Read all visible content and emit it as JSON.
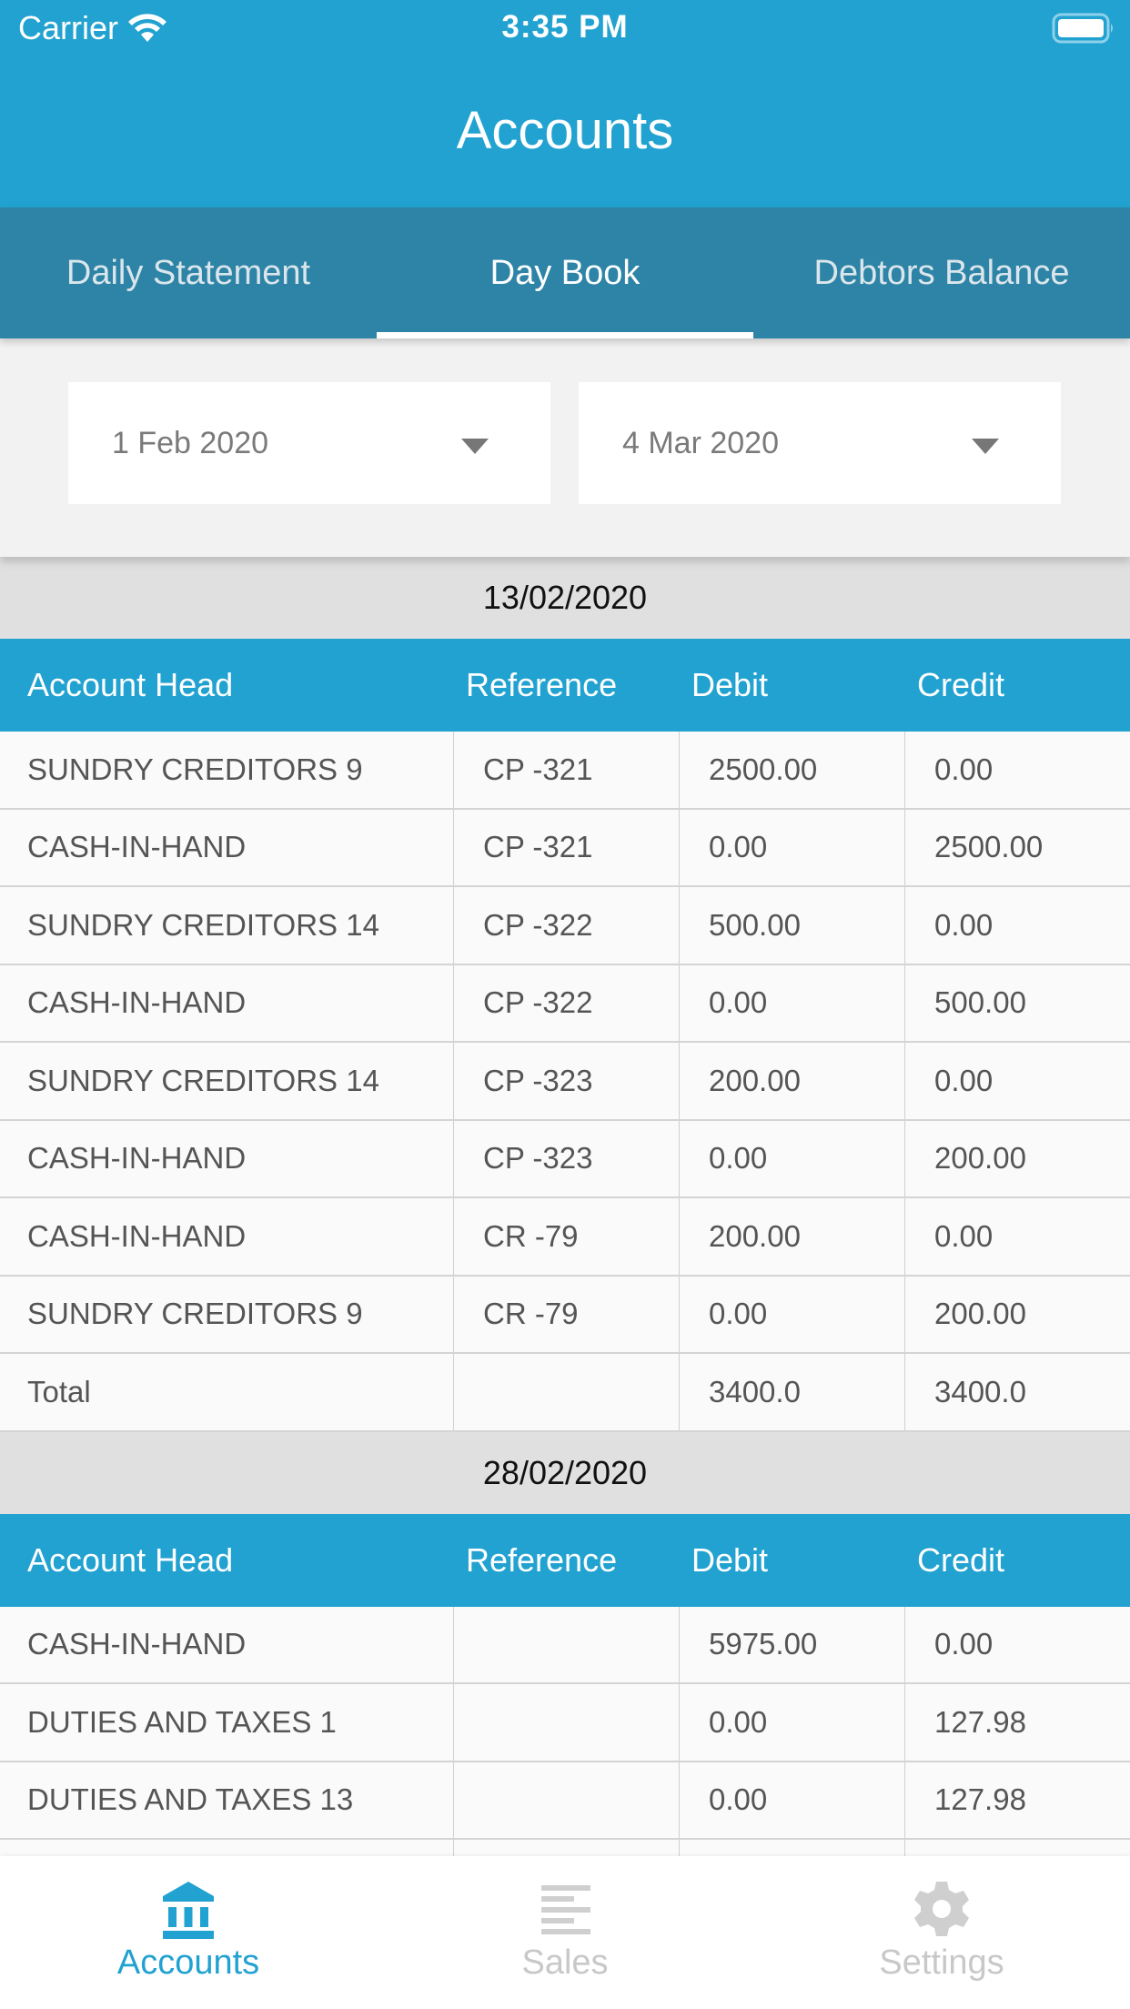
{
  "status_bar": {
    "carrier": "Carrier",
    "time": "3:35 PM",
    "wifi_icon": "wifi-icon",
    "battery_icon": "battery-full-icon"
  },
  "header": {
    "title": "Accounts"
  },
  "tabs": [
    {
      "label": "Daily Statement",
      "active": false
    },
    {
      "label": "Day Book",
      "active": true
    },
    {
      "label": "Debtors Balance",
      "active": false
    }
  ],
  "filters": {
    "from_date": "1 Feb 2020",
    "to_date": "4 Mar 2020",
    "caret_icon": "caret-down-icon"
  },
  "columns": [
    "Account Head",
    "Reference",
    "Debit",
    "Credit"
  ],
  "sections": [
    {
      "date": "13/02/2020",
      "rows": [
        {
          "account": "SUNDRY CREDITORS 9",
          "reference": "CP  -321",
          "debit": "2500.00",
          "credit": "0.00"
        },
        {
          "account": "CASH-IN-HAND",
          "reference": "CP  -321",
          "debit": "0.00",
          "credit": "2500.00"
        },
        {
          "account": "SUNDRY CREDITORS 14",
          "reference": "CP  -322",
          "debit": "500.00",
          "credit": "0.00"
        },
        {
          "account": "CASH-IN-HAND",
          "reference": "CP  -322",
          "debit": "0.00",
          "credit": "500.00"
        },
        {
          "account": "SUNDRY CREDITORS 14",
          "reference": "CP  -323",
          "debit": "200.00",
          "credit": "0.00"
        },
        {
          "account": "CASH-IN-HAND",
          "reference": "CP  -323",
          "debit": "0.00",
          "credit": "200.00"
        },
        {
          "account": "CASH-IN-HAND",
          "reference": "CR  -79",
          "debit": "200.00",
          "credit": "0.00"
        },
        {
          "account": "SUNDRY CREDITORS 9",
          "reference": "CR  -79",
          "debit": "0.00",
          "credit": "200.00"
        }
      ],
      "total": {
        "label": "Total",
        "debit": "3400.0",
        "credit": "3400.0"
      }
    },
    {
      "date": "28/02/2020",
      "rows": [
        {
          "account": "CASH-IN-HAND",
          "reference": "",
          "debit": "5975.00",
          "credit": "0.00"
        },
        {
          "account": "DUTIES AND TAXES 1",
          "reference": "",
          "debit": "0.00",
          "credit": "127.98"
        },
        {
          "account": "DUTIES AND TAXES 13",
          "reference": "",
          "debit": "0.00",
          "credit": "127.98"
        },
        {
          "account": "",
          "reference": "",
          "debit": "",
          "credit": ""
        }
      ]
    }
  ],
  "tabbar": [
    {
      "label": "Accounts",
      "icon": "bank-icon",
      "active": true
    },
    {
      "label": "Sales",
      "icon": "list-icon",
      "active": false
    },
    {
      "label": "Settings",
      "icon": "gear-icon",
      "active": false
    }
  ],
  "colors": {
    "primary": "#21a2d0",
    "tab_bar": "#2d84a6",
    "inactive_icon": "#c8c8c8"
  }
}
